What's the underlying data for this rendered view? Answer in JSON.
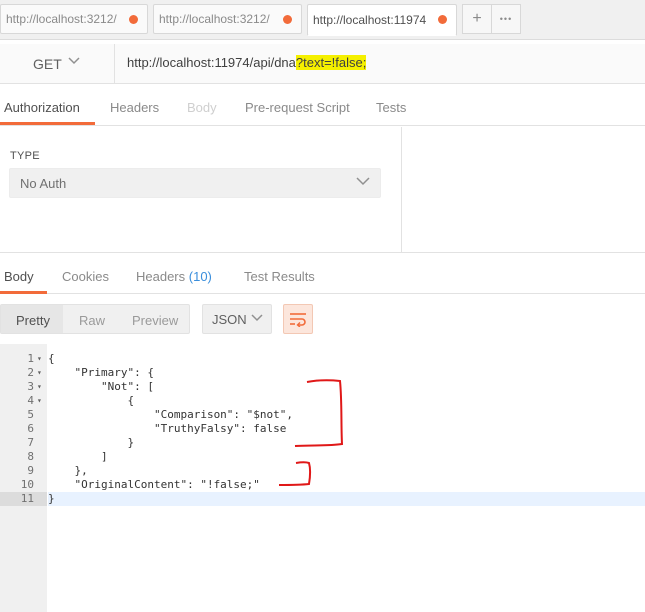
{
  "tabs": [
    {
      "label": "http://localhost:3212/",
      "unsaved": true
    },
    {
      "label": "http://localhost:3212/",
      "unsaved": true
    },
    {
      "label": "http://localhost:11974",
      "unsaved": true
    }
  ],
  "tab_actions": {
    "add": "+",
    "more": "•••"
  },
  "request": {
    "method": "GET",
    "url_base": "http://localhost:11974/api/dna",
    "url_query": "?text=!false;"
  },
  "request_tabs": [
    "Authorization",
    "Headers",
    "Body",
    "Pre-request Script",
    "Tests"
  ],
  "auth": {
    "type_label": "TYPE",
    "type_value": "No Auth"
  },
  "response_tabs": {
    "body": "Body",
    "cookies": "Cookies",
    "headers": "Headers",
    "headers_count": "(10)",
    "test_results": "Test Results"
  },
  "view_modes": [
    "Pretty",
    "Raw",
    "Preview"
  ],
  "format": "JSON",
  "code_lines": [
    "{",
    "    \"Primary\": {",
    "        \"Not\": [",
    "            {",
    "                \"Comparison\": \"$not\",",
    "                \"TruthyFalsy\": false",
    "            }",
    "        ]",
    "    },",
    "    \"OriginalContent\": \"!false;\"",
    "}"
  ],
  "line_numbers": [
    "1",
    "2",
    "3",
    "4",
    "5",
    "6",
    "7",
    "8",
    "9",
    "10",
    "11"
  ],
  "colors": {
    "accent": "#f26b3a",
    "highlight": "#f5f000",
    "annotation": "#e01818",
    "count": "#3a8edc"
  }
}
